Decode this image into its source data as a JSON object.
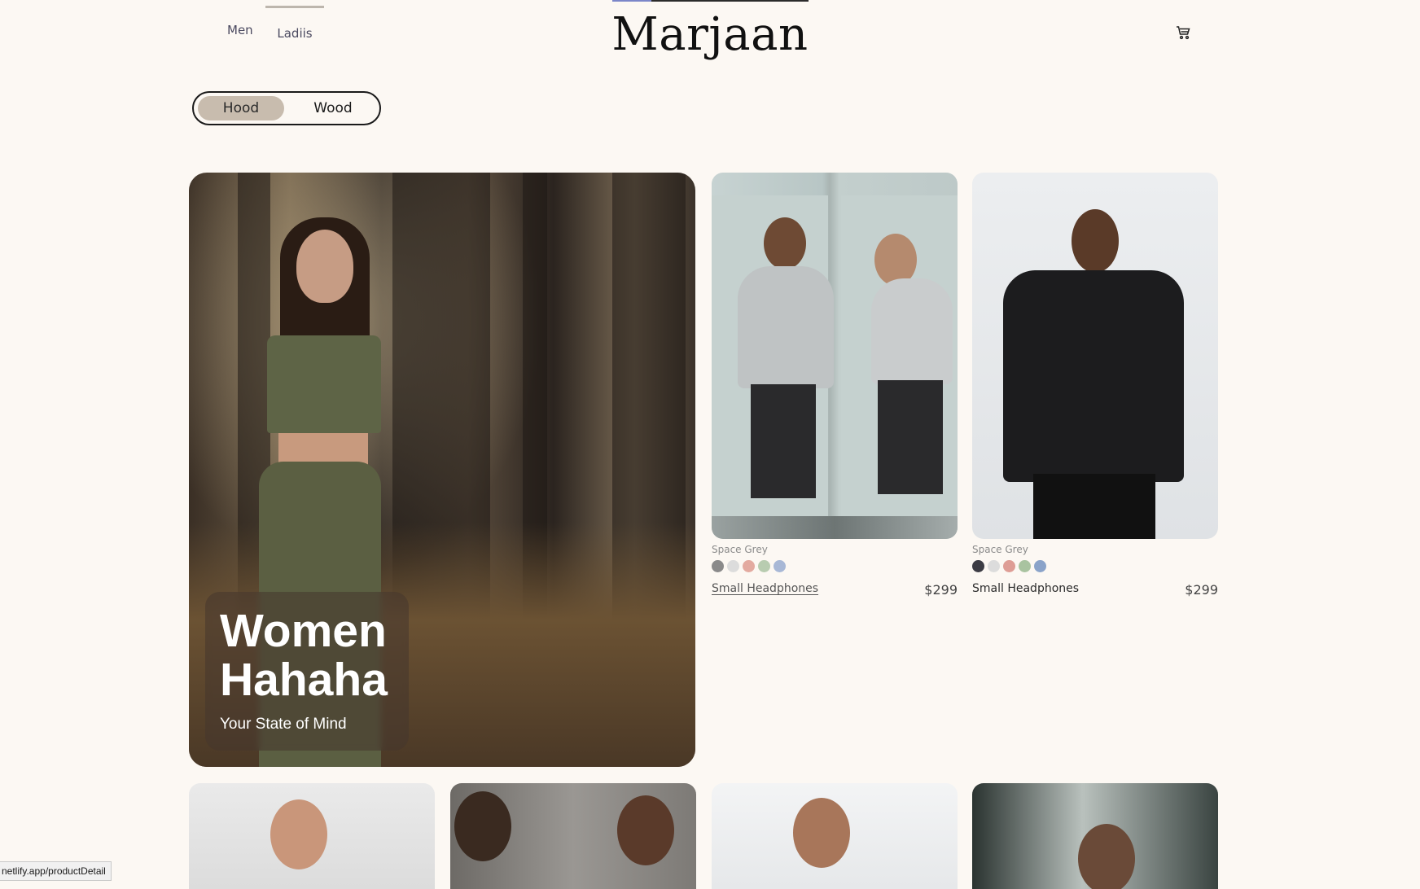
{
  "nav": {
    "tabs": [
      {
        "label": "Men"
      },
      {
        "label": "Ladiis"
      }
    ],
    "logo": "Marjaan",
    "cart_icon": "cart-icon"
  },
  "toggle": {
    "options": [
      "Hood",
      "Wood"
    ],
    "selected": "Hood"
  },
  "hero": {
    "title": "Women\nHahaha",
    "subtitle": "Your State of Mind"
  },
  "products": [
    {
      "color_name": "Space Grey",
      "swatches": [
        "#8a8a8a",
        "#dcdcdc",
        "#e3aaa0",
        "#b8ccb0",
        "#a8b8d6"
      ],
      "name": "Small Headphones",
      "price": "$299",
      "hovered": true
    },
    {
      "color_name": "Space Grey",
      "swatches": [
        "#3c3c44",
        "#dcdcdc",
        "#de9d95",
        "#a9c3a0",
        "#8aa3c9"
      ],
      "name": "Small Headphones",
      "price": "$299",
      "hovered": false
    }
  ],
  "status_bar": {
    "url": "netlify.app/productDetail"
  }
}
